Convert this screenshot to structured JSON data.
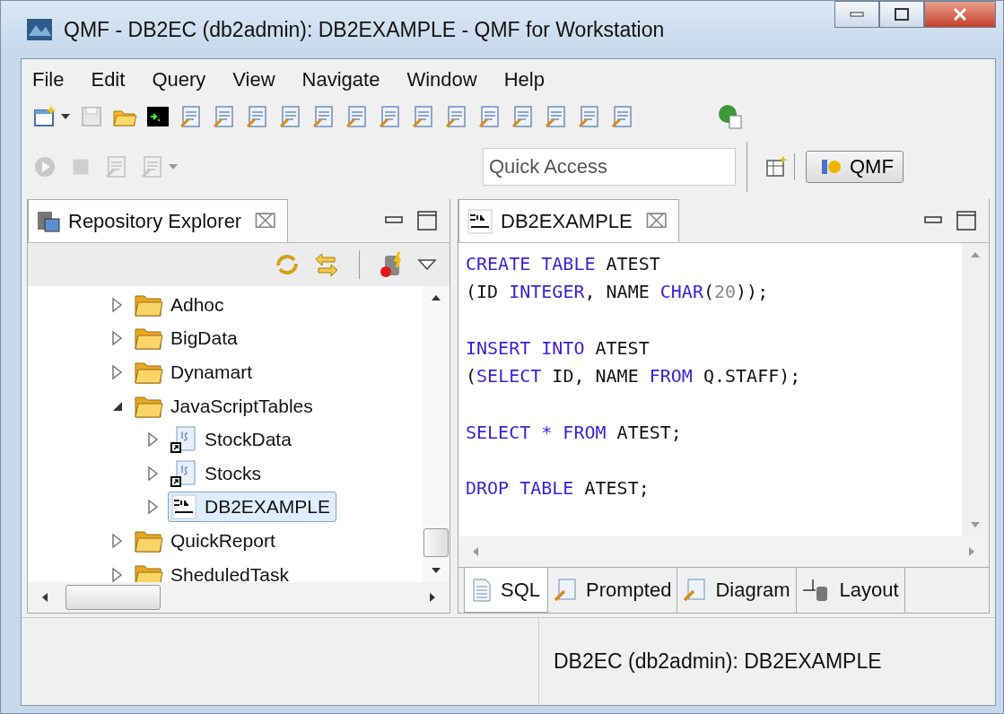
{
  "window": {
    "title": "QMF - DB2EC (db2admin): DB2EXAMPLE - QMF for Workstation"
  },
  "menu": [
    "File",
    "Edit",
    "Query",
    "View",
    "Navigate",
    "Window",
    "Help"
  ],
  "toolbar": [
    {
      "kind": "new",
      "disabled": false,
      "dropdown": true
    },
    {
      "kind": "save",
      "disabled": true,
      "dropdown": false
    },
    {
      "kind": "open",
      "disabled": false,
      "dropdown": false
    },
    {
      "kind": "console",
      "disabled": false,
      "dropdown": false
    },
    {
      "kind": "doc",
      "disabled": false,
      "dropdown": false
    },
    {
      "kind": "doc",
      "disabled": false,
      "dropdown": false
    },
    {
      "kind": "doc",
      "disabled": false,
      "dropdown": false
    },
    {
      "kind": "doc",
      "disabled": false,
      "dropdown": false
    },
    {
      "kind": "doc",
      "disabled": false,
      "dropdown": false
    },
    {
      "kind": "doc",
      "disabled": false,
      "dropdown": false
    },
    {
      "kind": "doc",
      "disabled": false,
      "dropdown": false
    },
    {
      "kind": "doc",
      "disabled": false,
      "dropdown": false
    },
    {
      "kind": "doc",
      "disabled": false,
      "dropdown": false
    },
    {
      "kind": "doc",
      "disabled": false,
      "dropdown": false
    },
    {
      "kind": "doc",
      "disabled": false,
      "dropdown": false
    },
    {
      "kind": "doc",
      "disabled": false,
      "dropdown": false
    },
    {
      "kind": "doc",
      "disabled": false,
      "dropdown": false
    },
    {
      "kind": "doc",
      "disabled": false,
      "dropdown": false
    }
  ],
  "toolbar_row2": [
    {
      "kind": "run",
      "disabled": true,
      "dropdown": false
    },
    {
      "kind": "stop",
      "disabled": true,
      "dropdown": false
    },
    {
      "kind": "doc",
      "disabled": true,
      "dropdown": false
    },
    {
      "kind": "doc",
      "disabled": true,
      "dropdown": true
    }
  ],
  "quick_access": {
    "placeholder": "Quick Access"
  },
  "perspective": {
    "label": "QMF",
    "selected": true
  },
  "repository_explorer": {
    "tab": {
      "label": "Repository Explorer",
      "close": "⌧"
    },
    "tree": [
      {
        "label": "Adhoc",
        "kind": "folder",
        "expanded": false,
        "selected": false
      },
      {
        "label": "BigData",
        "kind": "folder",
        "expanded": false,
        "selected": false
      },
      {
        "label": "Dynamart",
        "kind": "folder",
        "expanded": false,
        "selected": false
      },
      {
        "label": "JavaScriptTables",
        "kind": "folder",
        "expanded": true,
        "selected": false,
        "children": [
          {
            "label": "StockData",
            "kind": "js",
            "expanded": false,
            "selected": false
          },
          {
            "label": "Stocks",
            "kind": "js",
            "expanded": false,
            "selected": false
          },
          {
            "label": "DB2EXAMPLE",
            "kind": "sql",
            "expanded": false,
            "selected": true
          }
        ]
      },
      {
        "label": "QuickReport",
        "kind": "folder",
        "expanded": false,
        "selected": false
      },
      {
        "label": "SheduledTask",
        "kind": "folder",
        "expanded": false,
        "selected": false
      }
    ]
  },
  "editor": {
    "tab": {
      "label": "DB2EXAMPLE",
      "close": "⌧"
    },
    "statements": [
      [
        [
          {
            "text": "CREATE TABLE",
            "kind": "keyword"
          },
          {
            "text": " ATEST",
            "kind": "plain"
          }
        ],
        [
          {
            "text": "(ID ",
            "kind": "plain"
          },
          {
            "text": "INTEGER",
            "kind": "keyword"
          },
          {
            "text": ", NAME ",
            "kind": "plain"
          },
          {
            "text": "CHAR",
            "kind": "keyword"
          },
          {
            "text": "(",
            "kind": "plain"
          },
          {
            "text": "20",
            "kind": "number"
          },
          {
            "text": "));",
            "kind": "plain"
          }
        ]
      ],
      [
        [
          {
            "text": "INSERT INTO",
            "kind": "keyword"
          },
          {
            "text": " ATEST",
            "kind": "plain"
          }
        ],
        [
          {
            "text": "(",
            "kind": "plain"
          },
          {
            "text": "SELECT",
            "kind": "keyword"
          },
          {
            "text": " ID, NAME ",
            "kind": "plain"
          },
          {
            "text": "FROM",
            "kind": "keyword"
          },
          {
            "text": " Q.STAFF);",
            "kind": "plain"
          }
        ]
      ],
      [
        [
          {
            "text": "SELECT * FROM",
            "kind": "keyword"
          },
          {
            "text": " ATEST;",
            "kind": "plain"
          }
        ]
      ],
      [
        [
          {
            "text": "DROP TABLE",
            "kind": "keyword"
          },
          {
            "text": " ATEST;",
            "kind": "plain"
          }
        ]
      ]
    ],
    "bottom_tabs": [
      {
        "label": "SQL",
        "kind": "sql",
        "selected": true
      },
      {
        "label": "Prompted",
        "kind": "wand",
        "selected": false
      },
      {
        "label": "Diagram",
        "kind": "wand",
        "selected": false
      },
      {
        "label": "Layout",
        "kind": "layout",
        "selected": false
      }
    ]
  },
  "status_bar": {
    "text": "DB2EC (db2admin): DB2EXAMPLE"
  }
}
